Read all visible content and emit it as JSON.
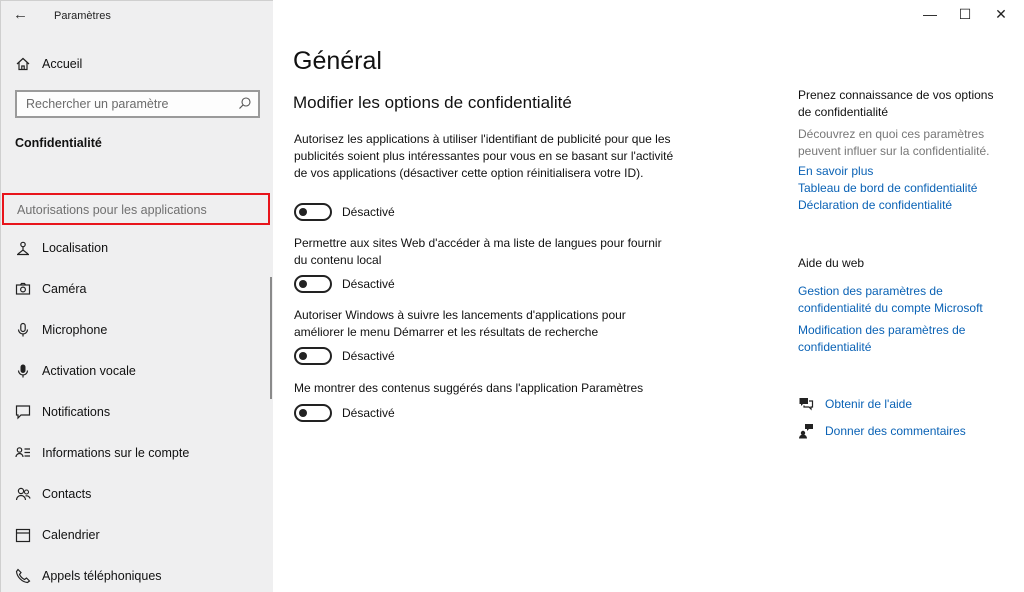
{
  "window": {
    "app_title": "Paramètres",
    "back_glyph": "←",
    "minimize_glyph": "—",
    "maximize_glyph": "☐",
    "close_glyph": "✕"
  },
  "sidebar": {
    "home_label": "Accueil",
    "search_placeholder": "Rechercher un paramètre",
    "section_title": "Confidentialité",
    "highlighted_item": "Autorisations pour les applications",
    "highlight_color": "#e8141b",
    "items": [
      {
        "label": "Localisation",
        "icon": "location-icon"
      },
      {
        "label": "Caméra",
        "icon": "camera-icon"
      },
      {
        "label": "Microphone",
        "icon": "microphone-icon"
      },
      {
        "label": "Activation vocale",
        "icon": "voice-activation-icon"
      },
      {
        "label": "Notifications",
        "icon": "notifications-icon"
      },
      {
        "label": "Informations sur le compte",
        "icon": "account-info-icon"
      },
      {
        "label": "Contacts",
        "icon": "contacts-icon"
      },
      {
        "label": "Calendrier",
        "icon": "calendar-icon"
      },
      {
        "label": "Appels téléphoniques",
        "icon": "phone-calls-icon"
      }
    ]
  },
  "main": {
    "title": "Général",
    "subtitle": "Modifier les options de confidentialité",
    "options": [
      {
        "text": "Autorisez les applications à utiliser l'identifiant de publicité pour que les publicités soient plus intéressantes pour vous en se basant sur l'activité de vos applications (désactiver cette option réinitialisera votre ID).",
        "toggle_label": "Désactivé"
      },
      {
        "text": "Permettre aux sites Web d'accéder à ma liste de langues pour fournir du contenu local",
        "toggle_label": "Désactivé"
      },
      {
        "text": "Autoriser Windows à suivre les lancements d'applications pour améliorer le menu Démarrer et les résultats de recherche",
        "toggle_label": "Désactivé"
      },
      {
        "text": "Me montrer des contenus suggérés dans l'application Paramètres",
        "toggle_label": "Désactivé"
      }
    ]
  },
  "right": {
    "intro_heading": "Prenez connaissance de vos options de confidentialité",
    "intro_text": "Découvrez en quoi ces paramètres peuvent influer sur la confidentialité.",
    "links": [
      "En savoir plus",
      "Tableau de bord de confidentialité",
      "Déclaration de confidentialité"
    ],
    "web_help_heading": "Aide du web",
    "web_links": [
      "Gestion des paramètres de confidentialité du compte Microsoft",
      "Modification des paramètres de confidentialité"
    ],
    "help_link": "Obtenir de l'aide",
    "feedback_link": "Donner des commentaires",
    "link_color": "#0a62b5"
  }
}
